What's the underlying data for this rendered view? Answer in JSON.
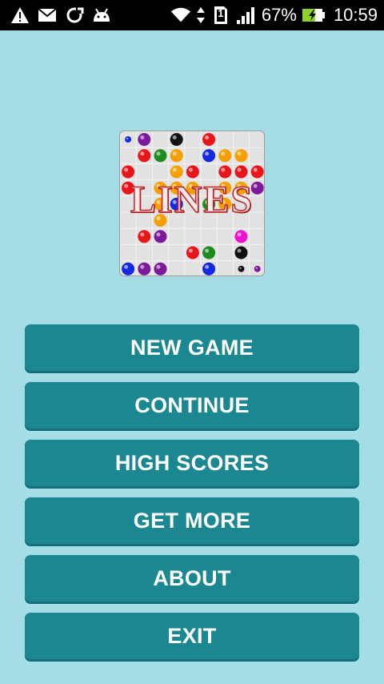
{
  "status_bar": {
    "battery_percent": "67%",
    "time": "10:59",
    "sim_slot": "1",
    "icons": [
      "warning-icon",
      "gmail-icon",
      "sync-icon",
      "android-debug-icon",
      "wifi-icon",
      "data-transfer-icon",
      "sim-icon",
      "signal-icon",
      "battery-charging-icon"
    ]
  },
  "logo": {
    "title": "LINES",
    "colors": {
      "red": "#e8151a",
      "purple": "#7d1a9a",
      "black": "#111111",
      "green": "#1e8b1e",
      "orange": "#f5a000",
      "blue": "#1428e0",
      "magenta": "#f010d0"
    }
  },
  "menu": {
    "new_game": "NEW GAME",
    "continue": "CONTINUE",
    "high_scores": "HIGH SCORES",
    "get_more": "GET MORE",
    "about": "ABOUT",
    "exit": "EXIT"
  },
  "theme": {
    "background": "#a4dde6",
    "button": "#1a8791",
    "button_text": "#ffffff"
  }
}
